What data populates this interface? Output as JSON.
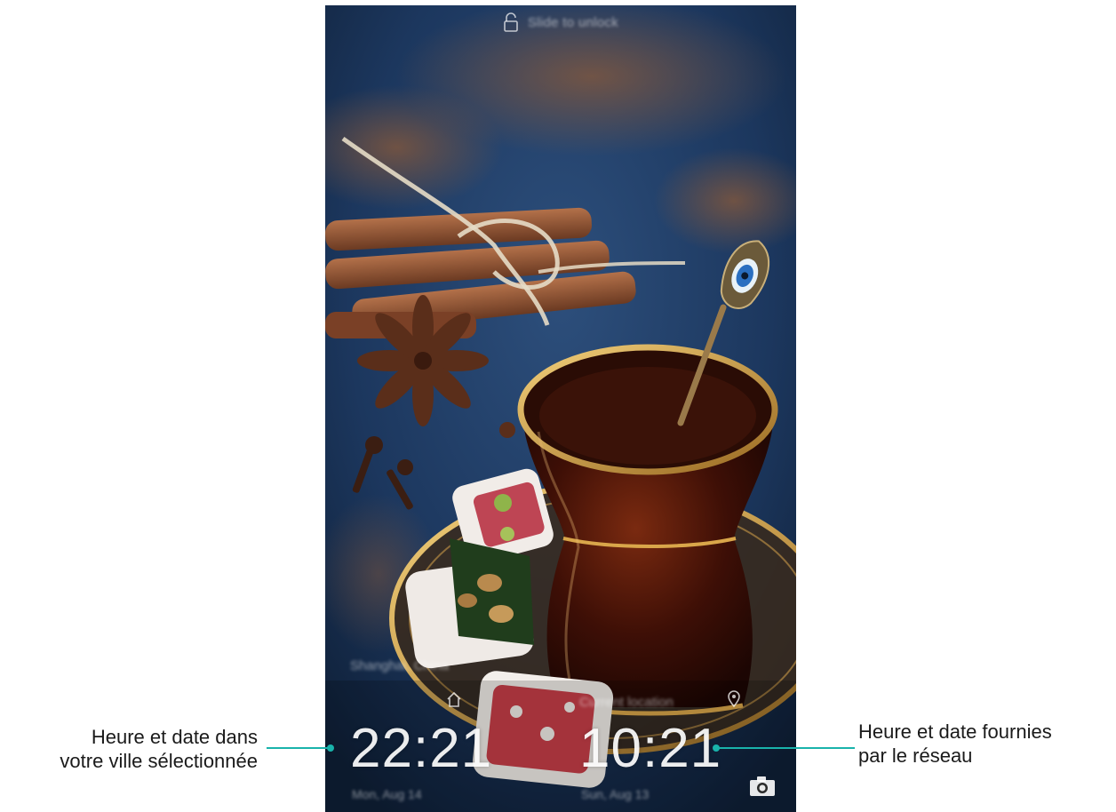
{
  "lockscreen": {
    "unlock_hint": "Slide to unlock",
    "left_clock": {
      "city": "Shanghai, China",
      "time": "22:21",
      "date": "Mon, Aug 14"
    },
    "right_clock": {
      "city": "Current location",
      "time": "10:21",
      "date": "Sun, Aug 13"
    },
    "icons": {
      "lock": "lock-icon",
      "home": "home-icon",
      "location": "location-pin-icon",
      "camera": "camera-icon"
    }
  },
  "callouts": {
    "left_line1": "Heure et date dans",
    "left_line2": "votre ville sélectionnée",
    "right_line1": "Heure et date fournies",
    "right_line2": "par le réseau"
  },
  "colors": {
    "accent": "#19b3ab",
    "background_blue": "#1d3a63"
  }
}
